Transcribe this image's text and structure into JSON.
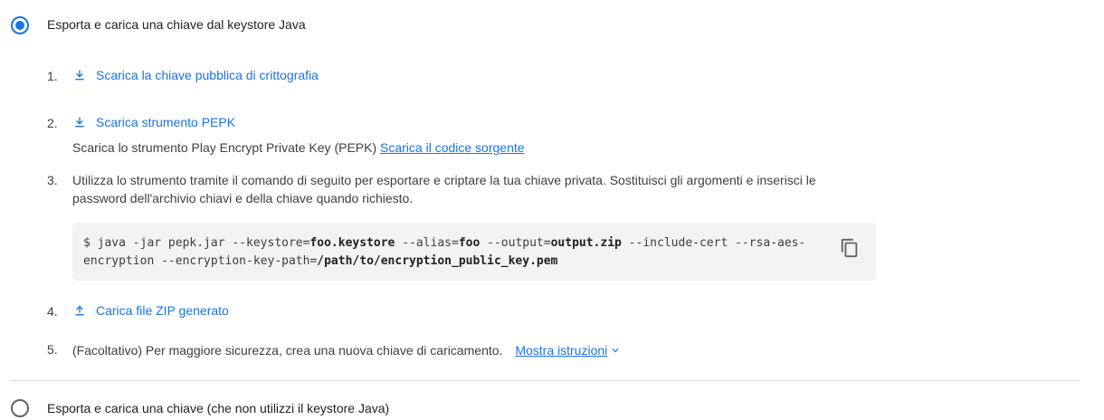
{
  "option1": {
    "label": "Esporta e carica una chiave dal keystore Java",
    "selected": true
  },
  "steps": {
    "s1": {
      "num": "1.",
      "link": "Scarica la chiave pubblica di crittografia",
      "icon": "download-icon"
    },
    "s2": {
      "num": "2.",
      "link": "Scarica strumento PEPK",
      "icon": "download-icon",
      "desc": "Scarica lo strumento Play Encrypt Private Key (PEPK)",
      "source_link": "Scarica il codice sorgente"
    },
    "s3": {
      "num": "3.",
      "text": "Utilizza lo strumento tramite il comando di seguito per esportare e criptare la tua chiave privata. Sostituisci gli argomenti e inserisci le password dell'archivio chiavi e della chiave quando richiesto.",
      "code": {
        "p1": "$ java -jar pepk.jar --keystore=",
        "a1": "foo.keystore",
        "p2": " --alias=",
        "a2": "foo",
        "p3": " --output=",
        "a3": "output.zip",
        "p4": " --include-cert --rsa-aes-encryption --encryption-key-path=",
        "a4": "/path/to/encryption_public_key.pem"
      },
      "copy_icon": "copy-icon"
    },
    "s4": {
      "num": "4.",
      "link": "Carica file ZIP generato",
      "icon": "upload-icon"
    },
    "s5": {
      "num": "5.",
      "text": "(Facoltativo) Per maggiore sicurezza, crea una nuova chiave di caricamento.",
      "more_link": "Mostra istruzioni",
      "more_icon": "chevron-down-icon"
    }
  },
  "option2": {
    "label": "Esporta e carica una chiave (che non utilizzi il keystore Java)",
    "selected": false
  },
  "colors": {
    "accent": "#1a73e8",
    "text": "#3c4043",
    "code_bg": "#f1f3f4",
    "divider": "#dadce0"
  }
}
